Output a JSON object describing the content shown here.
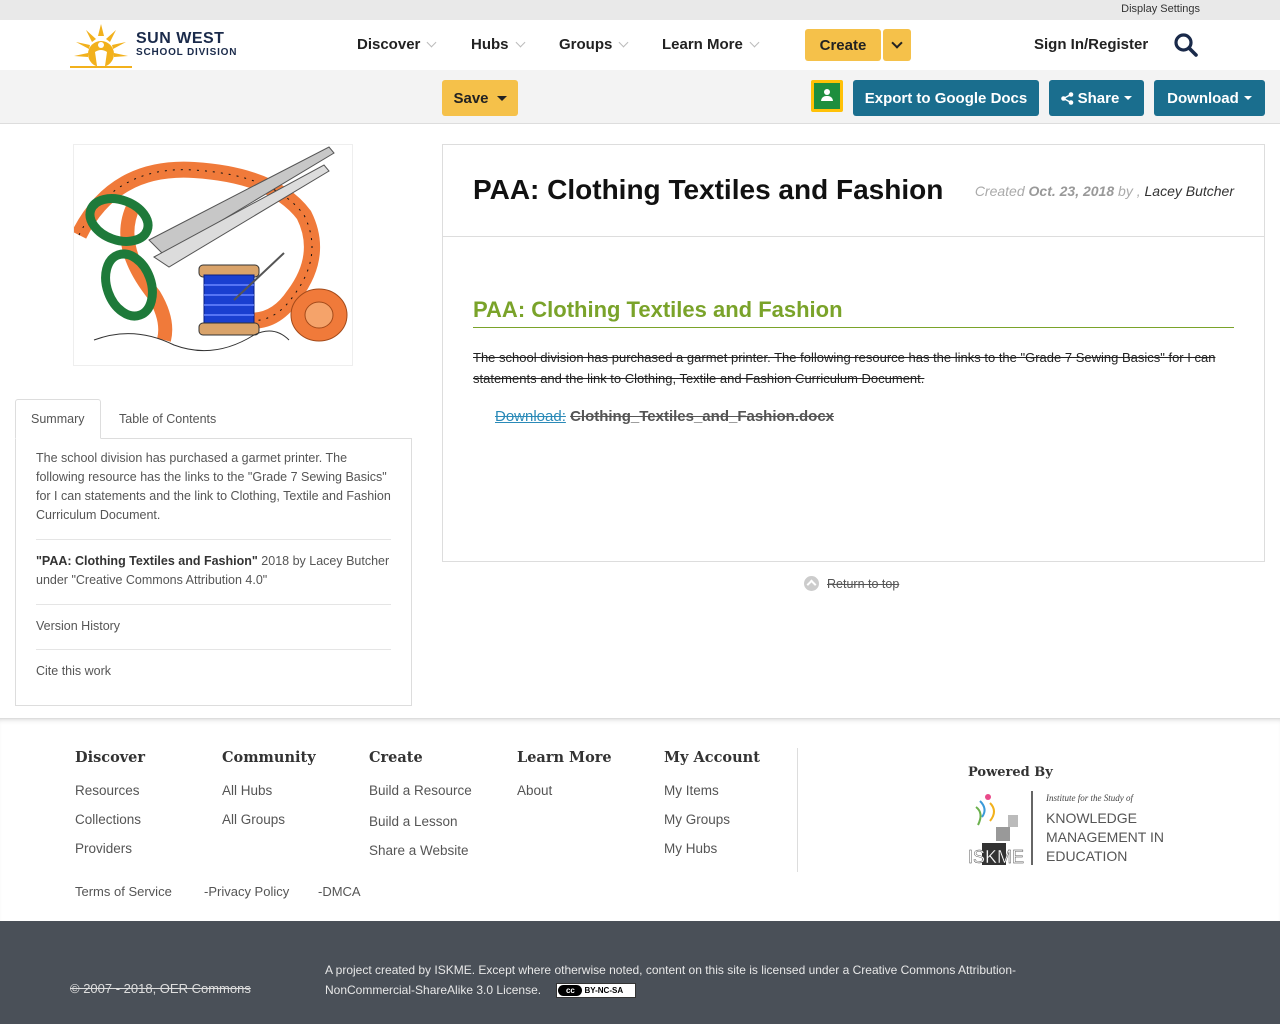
{
  "utility": {
    "display_settings": "Display Settings"
  },
  "logo": {
    "line1": "SUN WEST",
    "line2": "SCHOOL DIVISION"
  },
  "nav": {
    "items": [
      {
        "label": "Discover"
      },
      {
        "label": "Hubs"
      },
      {
        "label": "Groups"
      },
      {
        "label": "Learn More"
      }
    ],
    "create": "Create",
    "signin": "Sign In/Register"
  },
  "toolbar": {
    "save": "Save",
    "export": "Export to Google Docs",
    "share": "Share",
    "download": "Download"
  },
  "tabs": {
    "summary": "Summary",
    "toc": "Table of Contents"
  },
  "summary": {
    "text": "The school division has purchased a garmet printer. The following resource has the links to the \"Grade 7 Sewing Basics\" for I can statements and the link to Clothing, Textile and Fashion Curriculum Document.",
    "attr_title": "\"PAA: Clothing Textiles and Fashion\"",
    "attr_rest": " 2018 by Lacey Butcher under \"Creative Commons Attribution 4.0\"",
    "version_history": "Version History",
    "cite": "Cite this work"
  },
  "resource": {
    "title": "PAA: Clothing Textiles and Fashion",
    "created_label": "Created ",
    "created_date": "Oct. 23, 2018",
    "by": " by , ",
    "author": "Lacey Butcher",
    "heading": "PAA: Clothing Textiles and Fashion",
    "body": "The school division has purchased a garmet printer. The following resource has the links to the \"Grade 7 Sewing Basics\" for I can statements and the link to Clothing, Textile and Fashion Curriculum Document.",
    "download_label": "Download:",
    "download_file": "Clothing_Textiles_and_Fashion.docx",
    "return_top": "Return to top"
  },
  "footer": {
    "columns": [
      {
        "title": "Discover",
        "links": [
          "Resources",
          "Collections",
          "Providers"
        ]
      },
      {
        "title": "Community",
        "links": [
          "All Hubs",
          "All Groups"
        ]
      },
      {
        "title": "Create",
        "links": [
          "Build a Resource",
          "Build a Lesson",
          "Share a Website"
        ]
      },
      {
        "title": "Learn More",
        "links": [
          "About"
        ]
      },
      {
        "title": "My Account",
        "links": [
          "My Items",
          "My Groups",
          "My Hubs"
        ]
      }
    ],
    "powered_by": "Powered By",
    "iskme_small": "Institute for the Study of",
    "iskme_l1": "KNOWLEDGE",
    "iskme_l2": "MANAGEMENT IN",
    "iskme_l3": "EDUCATION",
    "iskme_mark": "ISKME",
    "legal": [
      "Terms of Service",
      "-Privacy Policy",
      "-DMCA"
    ],
    "copyright": "© 2007 - 2018, OER Commons",
    "project": "A project created by ISKME. Except where otherwise noted, content on this site is licensed under a Creative Commons Attribution-NonCommercial-ShareAlike 3.0 License.",
    "cc_badge": "BY-NC-SA",
    "cc_mark": "cc"
  },
  "colors": {
    "accent_yellow": "#f5c14a",
    "teal": "#1a6e8e",
    "heading_green": "#7aa32a",
    "footer_dark": "#4a5058"
  }
}
